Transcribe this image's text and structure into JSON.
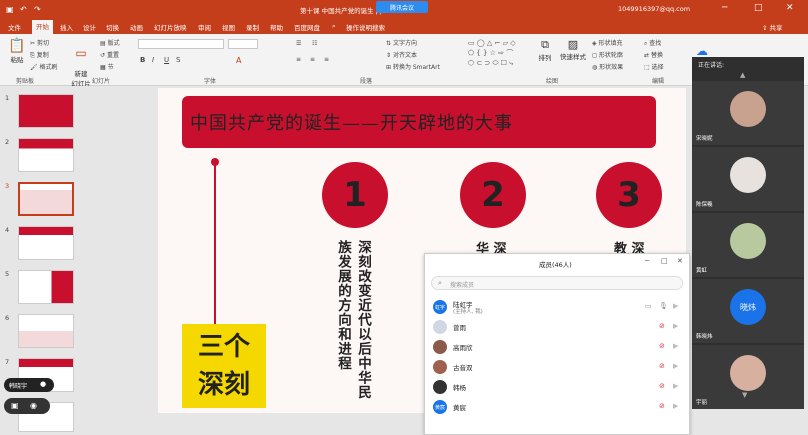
{
  "titlebar": {
    "file_name": "第十课 中国共产党的诞生 pptx",
    "meeting_app": "腾讯会议",
    "account": "1049916397@qq.com",
    "share_label": "共享"
  },
  "tabs": [
    "文件",
    "开始",
    "插入",
    "设计",
    "切换",
    "动画",
    "幻灯片放映",
    "审阅",
    "视图",
    "录制",
    "帮助",
    "百度网盘",
    "操作说明搜索"
  ],
  "active_tab": "开始",
  "ribbon": {
    "paste_label": "粘贴",
    "cut_label": "剪切",
    "copy_label": "复制",
    "format_painter_label": "格式刷",
    "new_slide_label": "新建\n幻灯片",
    "layout_label": "版式",
    "reset_label": "重置",
    "section_label": "节",
    "text_direction_label": "文字方向",
    "align_text_label": "对齐文本",
    "smartart_label": "转换为 SmartArt",
    "arrange_label": "排列",
    "quick_styles_label": "快速样式",
    "shape_fill_label": "形状填充",
    "shape_outline_label": "形状轮廓",
    "shape_effects_label": "形状效果",
    "find_label": "查找",
    "replace_label": "替换",
    "select_label": "选择",
    "groups": [
      "剪贴板",
      "幻灯片",
      "字体",
      "段落",
      "绘图",
      "编辑"
    ]
  },
  "thumbnails": [
    "1",
    "2",
    "3",
    "4",
    "5",
    "6",
    "7",
    "8"
  ],
  "slide": {
    "title": "中国共产党的诞生——开天辟地的大事",
    "circles": [
      "1",
      "2",
      "3"
    ],
    "col1_line1": "深刻改变近代以后中华民",
    "col1_line2": "族发展的方向和进程",
    "col2_partial": "华 深",
    "col3_partial": "教 深",
    "yellow_box": "三个\n深刻"
  },
  "members_dialog": {
    "title": "成员(46人)",
    "search_placeholder": "搜索成员",
    "members": [
      {
        "name": "陆虹宇",
        "sub": "(主持人, 我)",
        "avatar": "虹宇"
      },
      {
        "name": "曾雨",
        "sub": "",
        "avatar": ""
      },
      {
        "name": "高雨欣",
        "sub": "",
        "avatar": ""
      },
      {
        "name": "古音双",
        "sub": "",
        "avatar": ""
      },
      {
        "name": "韩杨",
        "sub": "",
        "avatar": ""
      },
      {
        "name": "黄宸",
        "sub": "",
        "avatar": "黄宸"
      }
    ]
  },
  "speaking_panel": {
    "label": "正在讲话:",
    "participants": [
      {
        "name": "宋晓妮",
        "avatar_text": ""
      },
      {
        "name": "陈保羲",
        "avatar_text": ""
      },
      {
        "name": "黄虹",
        "avatar_text": ""
      },
      {
        "name": "韩晓炜",
        "avatar_text": "晓炜"
      },
      {
        "name": "宇丽",
        "avatar_text": ""
      }
    ]
  },
  "floating": {
    "speaker_name": "韩晓宇"
  },
  "colors": {
    "ppt_red": "#c43e1c",
    "slide_red": "#c8102e",
    "yellow": "#f5d800",
    "meeting_blue": "#1a73e8"
  }
}
